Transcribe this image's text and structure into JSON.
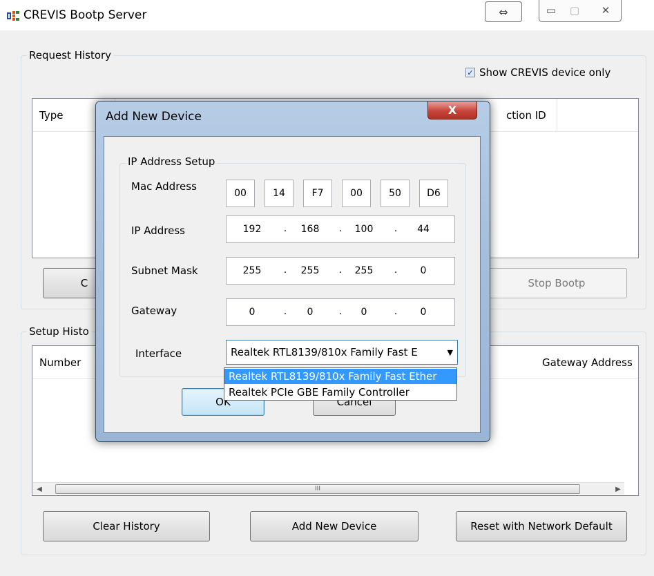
{
  "window": {
    "title": "CREVIS Bootp Server",
    "resize_glyph": "⇔",
    "minimize_glyph": "▭",
    "maximize_glyph": "▢",
    "close_glyph": "✕"
  },
  "request_history": {
    "label": "Request History",
    "show_crevis_label": "Show CREVIS device only",
    "show_crevis_checked": true,
    "columns": [
      "Type",
      "ction ID"
    ],
    "buttons": {
      "left_partial": "C",
      "stop_bootp": "Stop Bootp"
    }
  },
  "setup_history": {
    "label": "Setup Histo",
    "columns": [
      "Number",
      "Gateway Address"
    ],
    "scroll_thumb_glyph": "III",
    "buttons": {
      "clear_history": "Clear History",
      "add_new_device": "Add New Device",
      "reset_network_default": "Reset with Network Default"
    }
  },
  "dialog": {
    "title": "Add New Device",
    "close_glyph": "X",
    "group_label": "IP Address Setup",
    "labels": {
      "mac": "Mac Address",
      "ip": "IP Address",
      "subnet": "Subnet Mask",
      "gateway": "Gateway",
      "interface": "Interface"
    },
    "mac": [
      "00",
      "14",
      "F7",
      "00",
      "50",
      "D6"
    ],
    "ip": [
      "192",
      "168",
      "100",
      "44"
    ],
    "subnet": [
      "255",
      "255",
      "255",
      "0"
    ],
    "gateway": [
      "0",
      "0",
      "0",
      "0"
    ],
    "interface_selected": "Realtek RTL8139/810x Family Fast E",
    "interface_options": [
      "Realtek RTL8139/810x Family Fast Ether",
      "Realtek PCIe GBE Family Controller"
    ],
    "ok_partial": "OK",
    "cancel_partial": "Cancel"
  }
}
